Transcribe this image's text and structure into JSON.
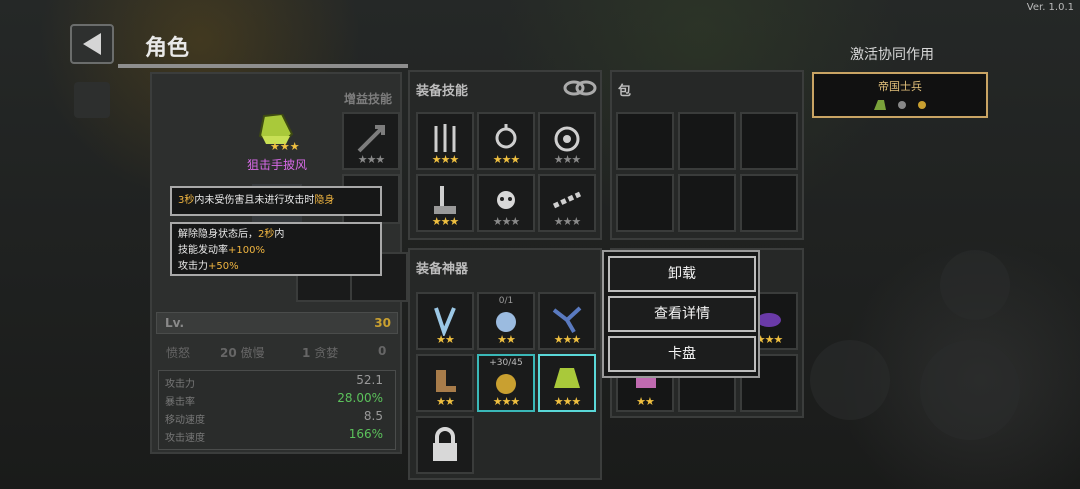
{
  "version": "Ver. 1.0.1",
  "header": {
    "title": "角色"
  },
  "synergy": {
    "heading": "激活协同作用",
    "badge_title": "帝国士兵"
  },
  "character": {
    "boost_skill_label": "增益技能",
    "equipped_item_name": "狙击手披风",
    "equipped_item_stars": "★★★",
    "tooltip_line1_part1": "3秒",
    "tooltip_line1_part2": "内未受伤害且未进行攻击时",
    "tooltip_line1_part3": "隐身",
    "tooltip_line2_part1": "解除隐身状态后，",
    "tooltip_line2_part2": "2秒",
    "tooltip_line2_part3": "内",
    "tooltip_line3_part1": "技能发动率",
    "tooltip_line3_part2": "+100%",
    "tooltip_line4_part1": "攻击力",
    "tooltip_line4_part2": "+50%",
    "level_label": "Lv.",
    "level_value": "30",
    "traits": [
      {
        "label": "愤怒",
        "value": "20"
      },
      {
        "label": "傲慢",
        "value": "1"
      },
      {
        "label": "贪婪",
        "value": "0"
      }
    ],
    "stats": [
      {
        "label": "攻击力",
        "value": "52.1"
      },
      {
        "label": "暴击率",
        "value": "28.00%"
      },
      {
        "label": "移动速度",
        "value": "8.5"
      },
      {
        "label": "攻击速度",
        "value": "166%"
      }
    ]
  },
  "skills": {
    "label": "装备技能",
    "slots": [
      {
        "icon": "spears-skill-icon",
        "stars": "★★★"
      },
      {
        "icon": "totem-skill-icon",
        "stars": "★★★"
      },
      {
        "icon": "wheel-skill-icon",
        "stars": "★★★"
      },
      {
        "icon": "sword-stone-skill-icon",
        "stars": "★★★"
      },
      {
        "icon": "skull-burst-skill-icon",
        "stars": "★★★"
      },
      {
        "icon": "chain-skill-icon",
        "stars": "★★★"
      }
    ]
  },
  "artifacts": {
    "label": "装备神器",
    "slots": [
      {
        "icon": "feather-blades-icon",
        "stars": "★★",
        "counter": ""
      },
      {
        "icon": "blue-orb-icon",
        "stars": "★★",
        "counter": "0/1"
      },
      {
        "icon": "ice-crystal-icon",
        "stars": "★★★",
        "counter": ""
      },
      {
        "icon": "winged-boot-icon",
        "stars": "★★",
        "counter": ""
      },
      {
        "icon": "gold-coin-icon",
        "stars": "★★★",
        "counter": "+30/45"
      },
      {
        "icon": "green-cloak-icon",
        "stars": "★★★",
        "counter": ""
      }
    ]
  },
  "bag": {
    "label": "包",
    "artifact_stars": [
      "★★★",
      "★★"
    ]
  },
  "context_menu": {
    "unequip": "卸载",
    "details": "查看详情",
    "deck": "卡盘"
  },
  "colors": {
    "accent_gold": "#f0b540",
    "stat_green": "#5bc15b"
  }
}
